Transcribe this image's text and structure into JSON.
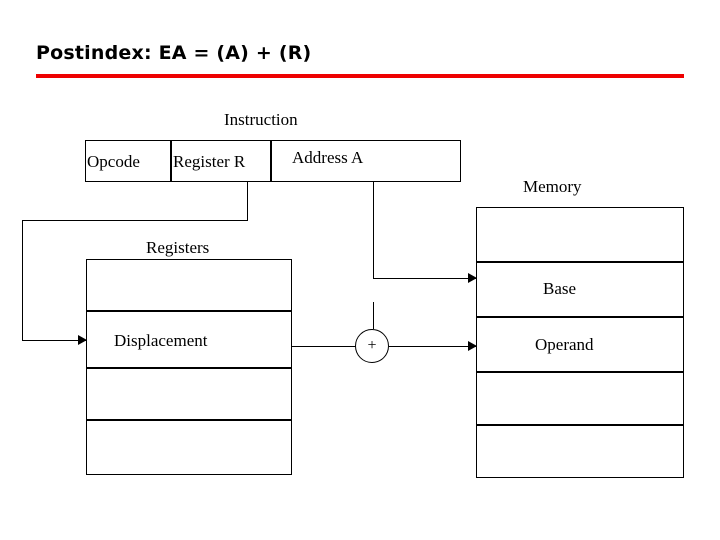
{
  "slide": {
    "title": "Postindex: EA = (A) + (R)",
    "accent_color": "#ee0000",
    "line_color": "#000000",
    "background": "#ffffff"
  },
  "labels": {
    "instruction": "Instruction",
    "memory": "Memory",
    "registers": "Registers"
  },
  "instruction_fields": {
    "opcode": "Opcode",
    "register": "Register R",
    "address": "Address A"
  },
  "registers_cells": {
    "displacement": "Displacement"
  },
  "memory_cells": {
    "base": "Base",
    "operand": "Operand"
  },
  "adder": {
    "symbol": "+"
  }
}
